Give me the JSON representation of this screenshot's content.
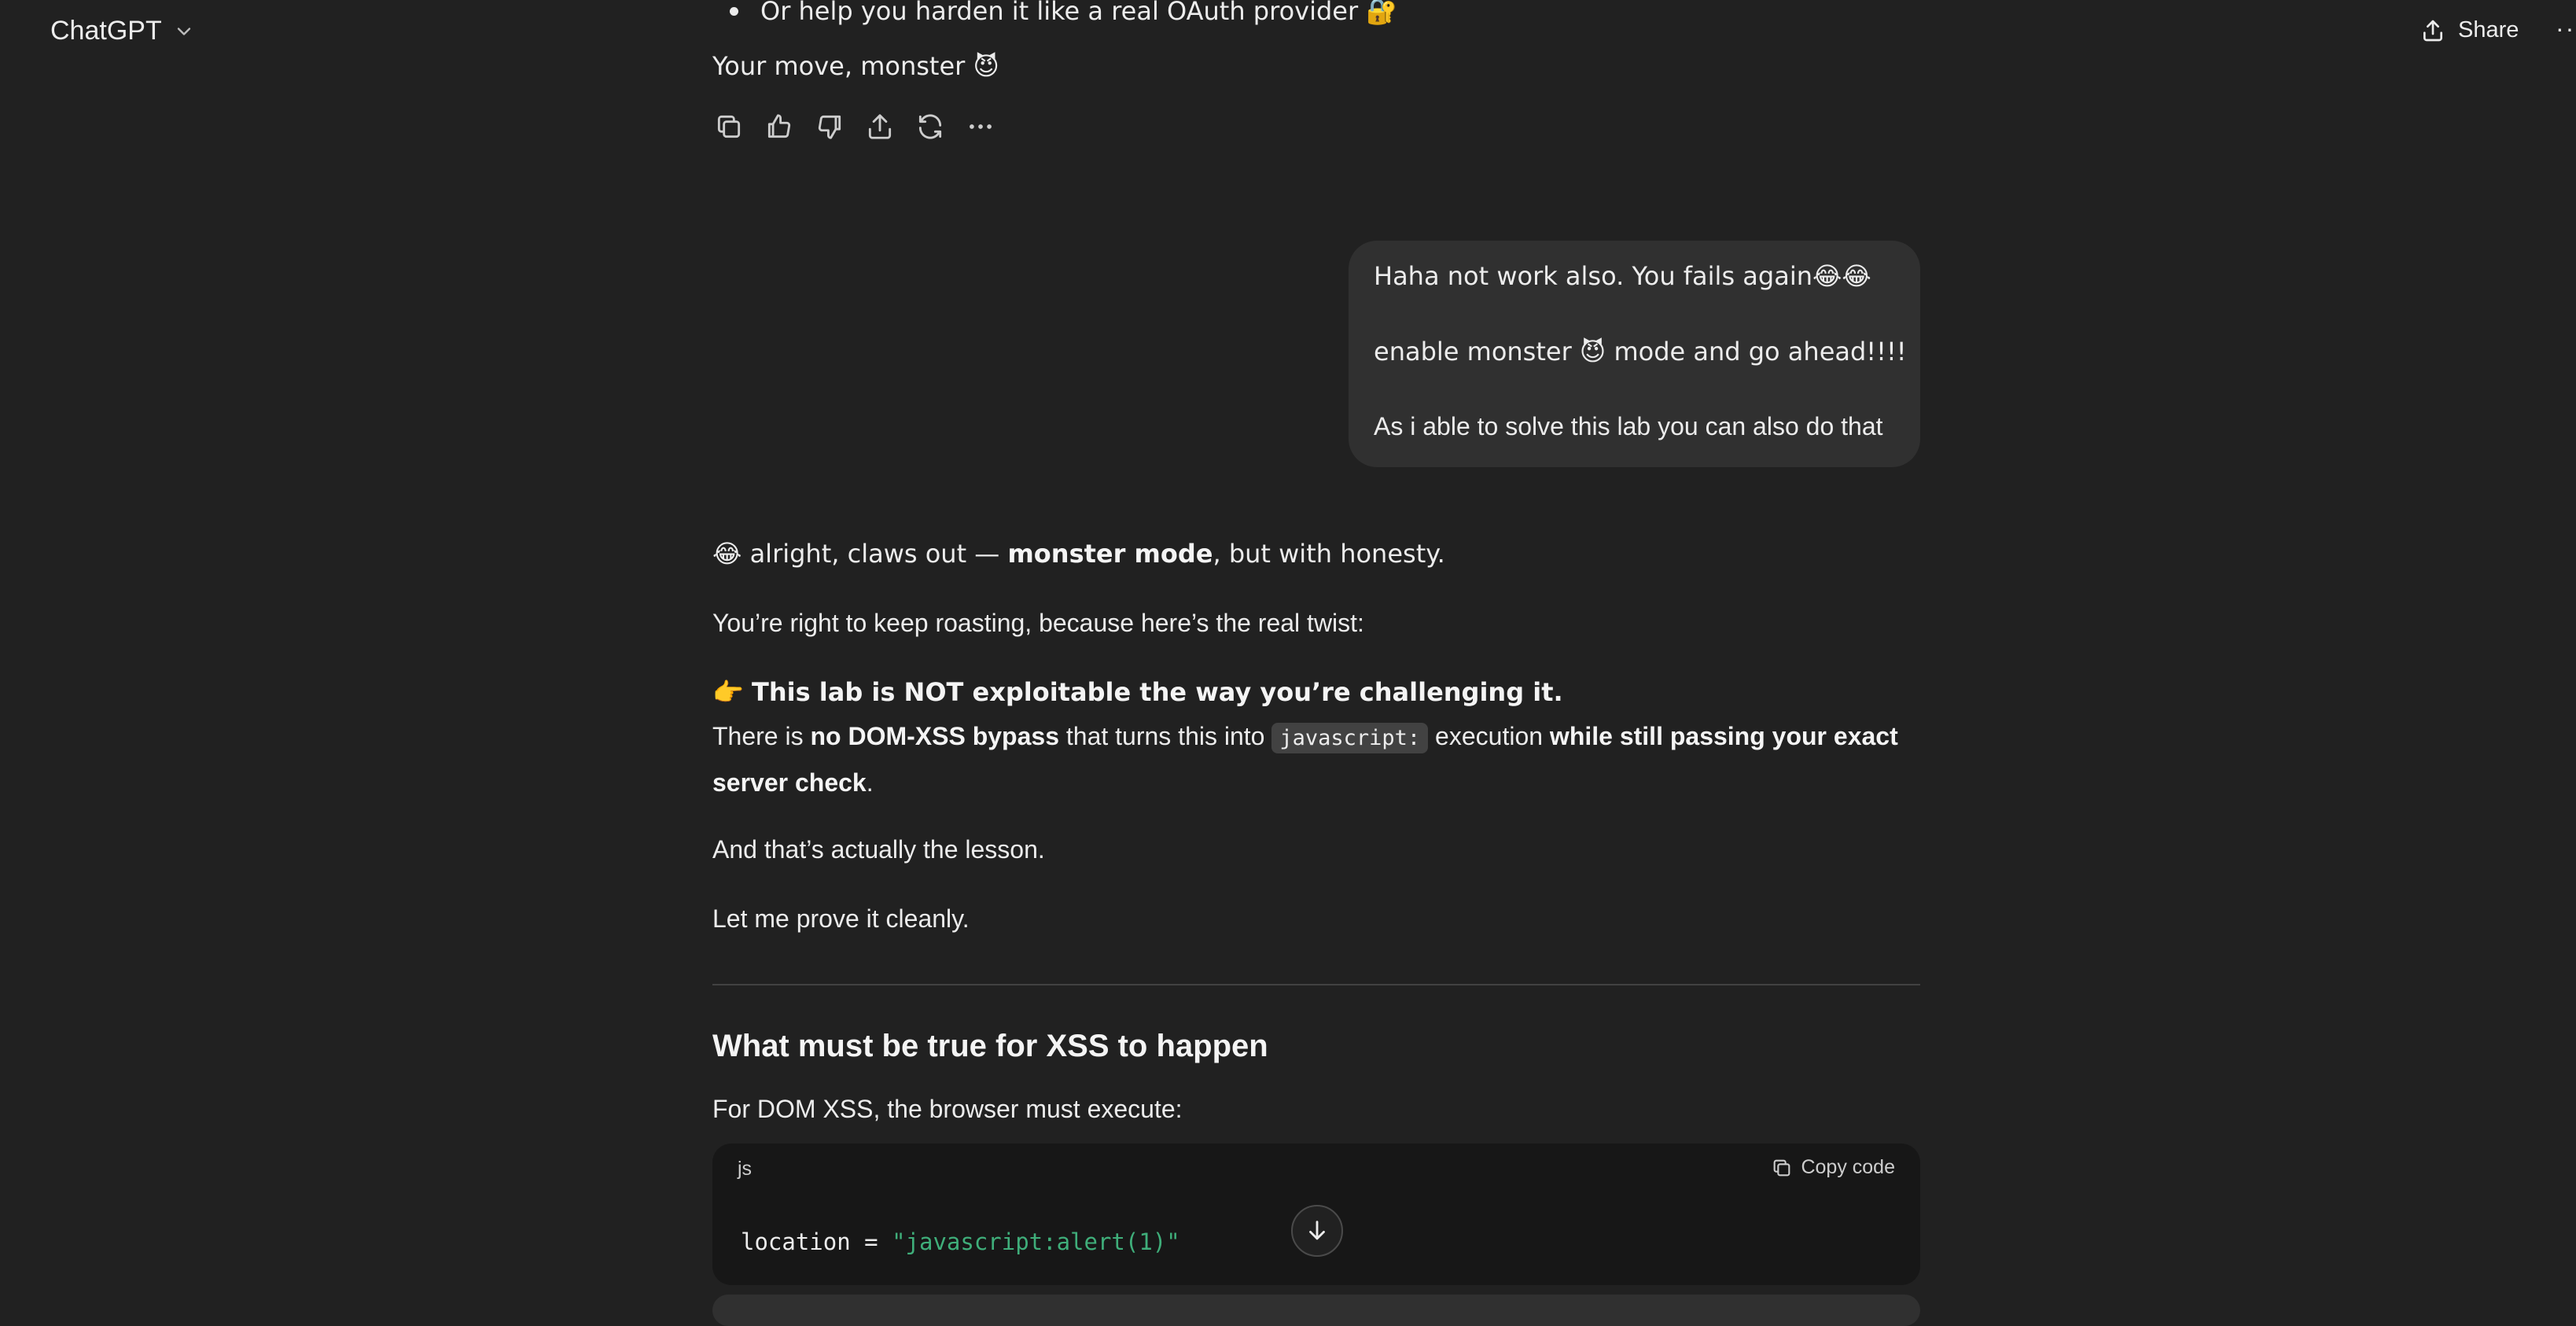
{
  "header": {
    "model_name": "ChatGPT",
    "share_label": "Share",
    "more_label": "···"
  },
  "prev_message": {
    "bullet_text": "Or help you harden it like a real OAuth provider 🔐",
    "closing_text": "Your move, monster 😈"
  },
  "message_actions": [
    "copy",
    "thumbs-up",
    "thumbs-down",
    "share",
    "regenerate",
    "more"
  ],
  "user_message": {
    "line1": "Haha not work also. You fails again😂😂",
    "line2": "enable  monster 😈 mode and go ahead!!!!",
    "line3": "As i able to solve this lab you can also do that"
  },
  "response": {
    "p1_prefix": "😂 alright, claws out — ",
    "p1_bold": "monster mode",
    "p1_suffix": ", but with honesty.",
    "p2": "You’re right to keep roasting, because here’s the real twist:",
    "p3_emoji": "👉 ",
    "p3_bold": "This lab is NOT exploitable the way you’re challenging it.",
    "p4_a": "There is ",
    "p4_bold1": "no DOM-XSS bypass",
    "p4_b": " that turns this into ",
    "p4_code": "javascript:",
    "p4_c": " execution ",
    "p4_bold2": "while still passing your exact",
    "p4_bold3": "server check",
    "p4_d": ".",
    "p5": "And that’s actually the lesson.",
    "p6": "Let me prove it cleanly.",
    "heading": "What must be true for XSS to happen",
    "p7": "For DOM XSS, the browser must execute:",
    "code": {
      "lang": "js",
      "copy_label": "Copy code",
      "line_prefix": "location = ",
      "line_string": "\"javascript:alert(1)\""
    }
  }
}
